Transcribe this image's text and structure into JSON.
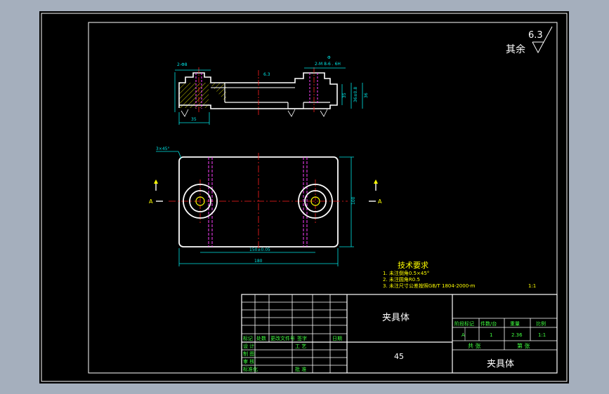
{
  "background": "#a5afbd",
  "canvas_color": "#000000",
  "colors": {
    "frame": "#ffffff",
    "outline": "#ffffff",
    "dimension": "#00e5e5",
    "hatch": "#ffff00",
    "centerline": "#ff2020",
    "hidden": "#ff40ff",
    "title_block": "#ffffff",
    "text_title": "#ffffff",
    "text_yellow": "#ffff00",
    "text_green": "#40ff40"
  },
  "roughness": {
    "prefix": "其余",
    "value": "6.3"
  },
  "top_view_dims": {
    "left_tol": "2-Φ8",
    "right_tol": "2-M 8-6 . 6H",
    "phi": "Φ",
    "width_left": "35",
    "height1": "35",
    "height2": "36±0.8",
    "height3": "36",
    "surface_mark": "6.3"
  },
  "plan_view_dims": {
    "chamfer": "3×45°",
    "section_left": "A",
    "section_right": "A",
    "height": "100",
    "spacing": "150±0.05",
    "length": "180"
  },
  "tech_requirements": {
    "title": "技术要求",
    "items": [
      "1.  未注倒角0.5×45°",
      "2.  未注圆角R0.5",
      "3.  未注尺寸公差按照GB/T 1804-2000-m"
    ],
    "extra_mark": "1:1"
  },
  "title_block": {
    "part_name": "夹具体",
    "material": "45",
    "drawing_name": "夹具体",
    "headers": [
      "阶段标记",
      "件数/台",
      "重量",
      "比例"
    ],
    "values": [
      "A",
      "1",
      "2.36",
      "1:1"
    ],
    "sheet_labels": [
      "共   张",
      "第   张"
    ],
    "change_row": [
      "标记",
      "处数",
      "更改文件号",
      "签字",
      "日期"
    ],
    "sign_rows": [
      "设 计",
      "制 图",
      "审 核",
      "标准化"
    ],
    "process_labels": [
      "工 艺",
      "批 准"
    ]
  }
}
